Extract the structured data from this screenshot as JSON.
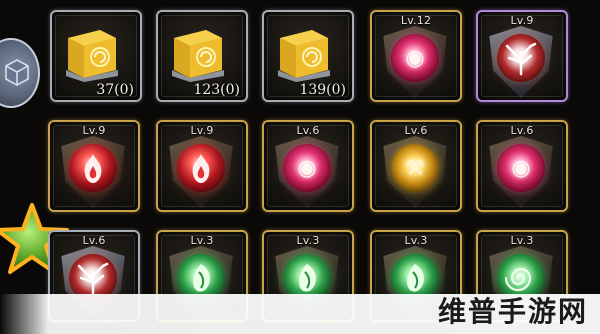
{
  "inventory": {
    "row1": [
      {
        "kind": "chest",
        "count": "37(0)"
      },
      {
        "kind": "chest",
        "count": "123(0)"
      },
      {
        "kind": "chest",
        "count": "139(0)"
      },
      {
        "kind": "orb",
        "level": "Lv.12",
        "color": "pink",
        "frame": "gold"
      },
      {
        "kind": "orb",
        "level": "Lv.9",
        "color": "white",
        "frame": "purple",
        "icon": "tree-icon"
      }
    ],
    "row2": [
      {
        "kind": "orb",
        "level": "Lv.9",
        "color": "red",
        "frame": "gold",
        "icon": "flame-icon"
      },
      {
        "kind": "orb",
        "level": "Lv.9",
        "color": "red",
        "frame": "gold",
        "icon": "flame-icon"
      },
      {
        "kind": "orb",
        "level": "Lv.6",
        "color": "pink",
        "frame": "gold"
      },
      {
        "kind": "orb",
        "level": "Lv.6",
        "color": "yellow",
        "frame": "gold"
      },
      {
        "kind": "orb",
        "level": "Lv.6",
        "color": "pink",
        "frame": "gold"
      }
    ],
    "row3": [
      {
        "kind": "orb",
        "level": "Lv.6",
        "color": "white",
        "frame": "silver",
        "icon": "tree-icon"
      },
      {
        "kind": "orb",
        "level": "Lv.3",
        "color": "green",
        "frame": "gold",
        "icon": "leaf-icon"
      },
      {
        "kind": "orb",
        "level": "Lv.3",
        "color": "green",
        "frame": "gold",
        "icon": "leaf-icon"
      },
      {
        "kind": "orb",
        "level": "Lv.3",
        "color": "green",
        "frame": "gold",
        "icon": "leaf-icon"
      },
      {
        "kind": "orb",
        "level": "Lv.3",
        "color": "green",
        "frame": "gold",
        "icon": "spiral-icon"
      }
    ]
  },
  "watermark": {
    "text": "维普手游网"
  },
  "colors": {
    "gold_frame": "#c9a24a",
    "silver_frame": "#a8acb4",
    "purple_frame": "#b28ad8"
  }
}
